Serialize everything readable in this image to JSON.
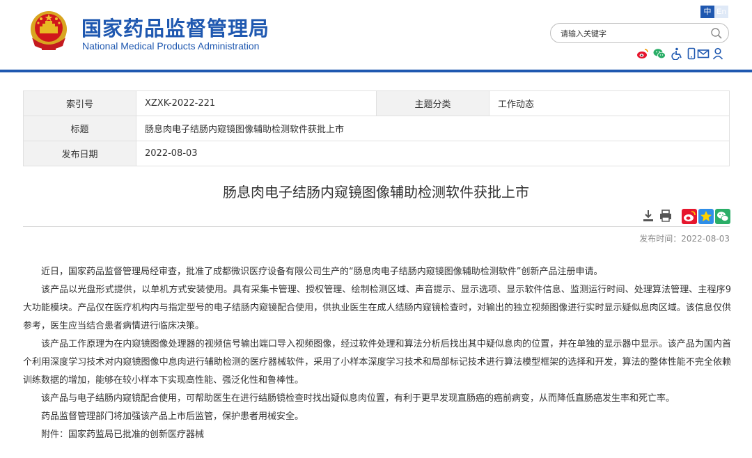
{
  "header": {
    "title_cn": "国家药品监督管理局",
    "title_en": "National Medical Products Administration",
    "lang_cn": "中",
    "lang_en": "En",
    "search_placeholder": "请输入关键字",
    "icons": [
      "weibo-icon",
      "wechat-icon",
      "accessibility-icon",
      "mobile-icon",
      "mail-icon",
      "user-icon"
    ]
  },
  "meta": {
    "index_label": "索引号",
    "index_value": "XZXK-2022-221",
    "category_label": "主题分类",
    "category_value": "工作动态",
    "title_label": "标题",
    "title_value": "肠息肉电子结肠内窥镜图像辅助检测软件获批上市",
    "date_label": "发布日期",
    "date_value": "2022-08-03"
  },
  "article": {
    "title": "肠息肉电子结肠内窥镜图像辅助检测软件获批上市",
    "publish_time": "发布时间：2022-08-03",
    "paragraphs": [
      "近日，国家药品监督管理局经审查，批准了成都微识医疗设备有限公司生产的“肠息肉电子结肠内窥镜图像辅助检测软件”创新产品注册申请。",
      "该产品以光盘形式提供，以单机方式安装使用。具有采集卡管理、授权管理、绘制检测区域、声音提示、显示选项、显示软件信息、监测运行时间、处理算法管理、主程序9大功能模块。产品仅在医疗机构内与指定型号的电子结肠内窥镜配合使用，供执业医生在成人结肠内窥镜检查时，对输出的独立视频图像进行实时显示疑似息肉区域。该信息仅供参考，医生应当结合患者病情进行临床决策。",
      "该产品工作原理为在内窥镜图像处理器的视频信号输出端口导入视频图像，经过软件处理和算法分析后找出其中疑似息肉的位置，并在单独的显示器中显示。该产品为国内首个利用深度学习技术对内窥镜图像中息肉进行辅助检测的医疗器械软件，采用了小样本深度学习技术和局部标记技术进行算法模型框架的选择和开发，算法的整体性能不完全依赖训练数据的增加，能够在较小样本下实现高性能、强泛化性和鲁棒性。",
      "该产品与电子结肠内窥镜配合使用，可帮助医生在进行结肠镜检查时找出疑似息肉位置，有利于更早发现直肠癌的癌前病变，从而降低直肠癌发生率和死亡率。",
      "药品监督管理部门将加强该产品上市后监管，保护患者用械安全。",
      "附件：国家药监局已批准的创新医疗器械"
    ]
  },
  "colors": {
    "brand_blue": "#1f58b0",
    "weibo_red": "#e6162d",
    "wechat_green": "#2aae67"
  }
}
